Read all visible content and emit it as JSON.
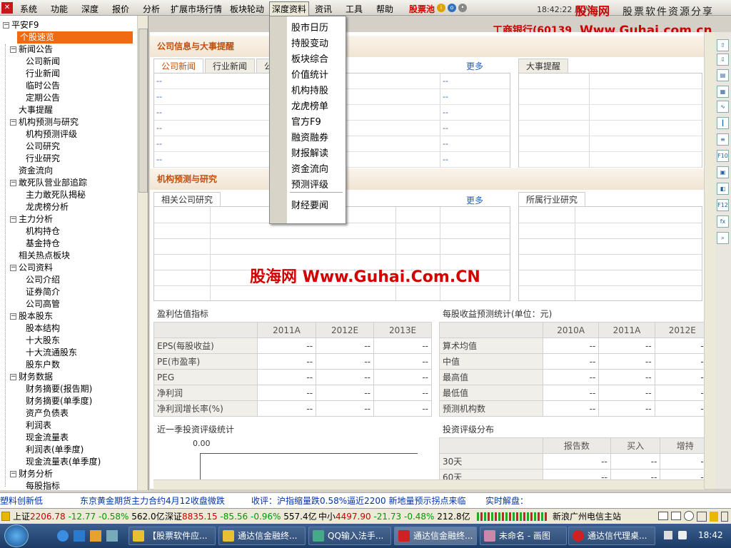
{
  "menubar": {
    "items": [
      "系统",
      "功能",
      "深度",
      "报价",
      "分析",
      "扩展市场行情",
      "板块轮动",
      "深度资料",
      "资讯",
      "工具",
      "帮助"
    ],
    "stock_pool": "股票池",
    "clock": "18:42:22 周六"
  },
  "brand": {
    "name": "股海网",
    "tagline": "股票软件资源分享",
    "url": "Www.Guhai.com.cn"
  },
  "stock_title": "工商银行(60139",
  "tree": {
    "root": "平安F9",
    "selected": "个股速览",
    "items": [
      {
        "label": "新闻公告",
        "level": 1,
        "group": true
      },
      {
        "label": "公司新闻",
        "level": 2
      },
      {
        "label": "行业新闻",
        "level": 2
      },
      {
        "label": "临时公告",
        "level": 2
      },
      {
        "label": "定期公告",
        "level": 2
      },
      {
        "label": "大事提醒",
        "level": 1
      },
      {
        "label": "机构预测与研究",
        "level": 1,
        "group": true
      },
      {
        "label": "机构预测评级",
        "level": 2
      },
      {
        "label": "公司研究",
        "level": 2
      },
      {
        "label": "行业研究",
        "level": 2
      },
      {
        "label": "资金流向",
        "level": 1
      },
      {
        "label": "敢死队营业部追踪",
        "level": 1,
        "group": true
      },
      {
        "label": "主力敢死队揭秘",
        "level": 2
      },
      {
        "label": "龙虎榜分析",
        "level": 2
      },
      {
        "label": "主力分析",
        "level": 1,
        "group": true
      },
      {
        "label": "机构持仓",
        "level": 2
      },
      {
        "label": "基金持仓",
        "level": 2
      },
      {
        "label": "相关热点板块",
        "level": 1
      },
      {
        "label": "公司资料",
        "level": 1,
        "group": true
      },
      {
        "label": "公司介绍",
        "level": 2
      },
      {
        "label": "证券简介",
        "level": 2
      },
      {
        "label": "公司高管",
        "level": 2
      },
      {
        "label": "股本股东",
        "level": 1,
        "group": true
      },
      {
        "label": "股本结构",
        "level": 2
      },
      {
        "label": "十大股东",
        "level": 2
      },
      {
        "label": "十大流通股东",
        "level": 2
      },
      {
        "label": "股东户数",
        "level": 2
      },
      {
        "label": "财务数据",
        "level": 1,
        "group": true
      },
      {
        "label": "财务摘要(报告期)",
        "level": 2
      },
      {
        "label": "财务摘要(单季度)",
        "level": 2
      },
      {
        "label": "资产负债表",
        "level": 2
      },
      {
        "label": "利润表",
        "level": 2
      },
      {
        "label": "现金流量表",
        "level": 2
      },
      {
        "label": "利润表(单季度)",
        "level": 2
      },
      {
        "label": "现金流量表(单季度)",
        "level": 2
      },
      {
        "label": "财务分析",
        "level": 1,
        "group": true
      },
      {
        "label": "每股指标",
        "level": 2
      }
    ]
  },
  "dropdown": {
    "items": [
      "股市日历",
      "持股变动",
      "板块综合",
      "价值统计",
      "机构持股",
      "龙虎榜单",
      "官方F9",
      "融资融券",
      "财报解读",
      "资金流向",
      "预测评级"
    ],
    "after_sep": "财经要闻"
  },
  "section1": {
    "title": "公司信息与大事提醒",
    "tabs": [
      "公司新闻",
      "行业新闻",
      "公"
    ],
    "more": "更多",
    "right_title": "大事提醒",
    "row_placeholder": "--"
  },
  "section2": {
    "title": "机构预测与研究",
    "left_title": "相关公司研究",
    "more": "更多",
    "right_title": "所属行业研究"
  },
  "watermark": "股海网 Www.Guhai.Com.CN",
  "valuation": {
    "title": "盈利估值指标",
    "headers": [
      "2011A",
      "2012E",
      "2013E"
    ],
    "rows": [
      "EPS(每股收益)",
      "PE(市盈率)",
      "PEG",
      "净利润",
      "净利润增长率(%)"
    ],
    "cell": "--"
  },
  "eps_forecast": {
    "title": "每股收益预测统计(单位：元)",
    "headers": [
      "2010A",
      "2011A",
      "2012E"
    ],
    "rows": [
      "算术均值",
      "中值",
      "最高值",
      "最低值",
      "预测机构数"
    ],
    "cell": "--"
  },
  "rating_stats": {
    "title": "近一季投资评级统计",
    "axis_value": "0.00"
  },
  "rating_dist": {
    "title": "投资评级分布",
    "headers": [
      "报告数",
      "买入",
      "增持"
    ],
    "rows": [
      "30天",
      "60天"
    ],
    "cell": "--"
  },
  "ticker": [
    {
      "text": "塑料创新低",
      "color": "#0033aa"
    },
    {
      "text": "东京黄金期货主力合约4月12收盘微跌",
      "color": "#0033aa"
    },
    {
      "text": "收评：沪指缩量跌0.58%逼近2200  新地量预示拐点来临",
      "color": "#0033aa"
    },
    {
      "text": "实时解盘：",
      "color": "#0033aa"
    }
  ],
  "status": {
    "sh_label": "上证",
    "sh_val": "2206.78",
    "sh_chg": "-12.77",
    "sh_pct": "-0.58%",
    "sh_vol": "562.0亿",
    "sz_label": "深证",
    "sz_val": "8835.15",
    "sz_chg": "-85.56",
    "sz_pct": "-0.96%",
    "sz_vol": "557.4亿",
    "zx_label": "中小",
    "zx_val": "4497.90",
    "zx_chg": "-21.73",
    "zx_pct": "-0.48%",
    "zx_vol": "212.8亿",
    "server": "新浪广州电信主站"
  },
  "taskbar": {
    "buttons": [
      "【股票软件应...",
      "通达信金融终...",
      "QQ输入法手...",
      "通达信金融终...",
      "未命名 - 画图",
      "通达信代理桌..."
    ],
    "clock": "18:42"
  },
  "colors": {
    "accent": "#f06a14",
    "brand_red": "#cc0000",
    "section_text": "#c0500c"
  }
}
